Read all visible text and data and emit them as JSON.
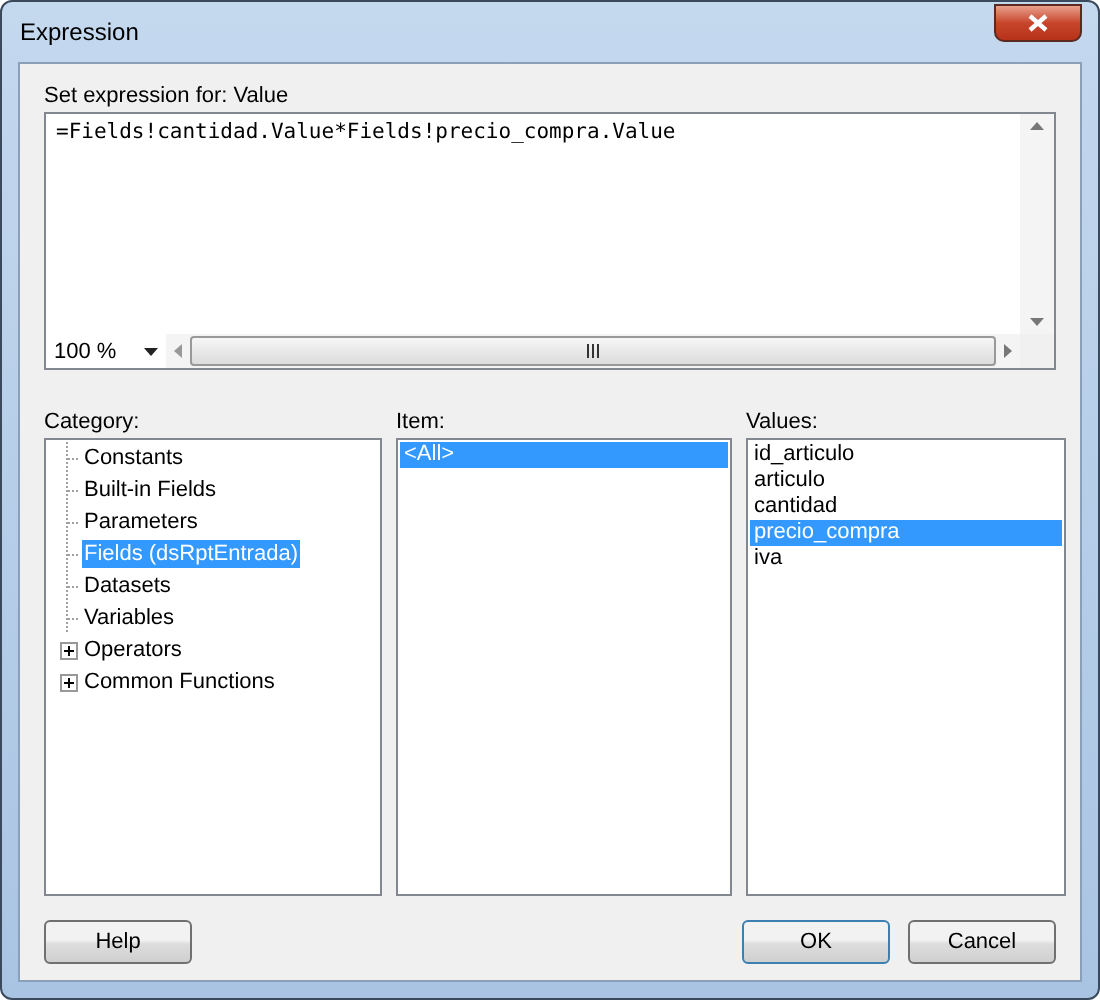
{
  "window": {
    "title": "Expression"
  },
  "expression": {
    "label": "Set expression for: Value",
    "value": "=Fields!cantidad.Value*Fields!precio_compra.Value",
    "zoom": "100 %"
  },
  "category": {
    "label": "Category:",
    "items": [
      {
        "label": "Constants",
        "selected": false,
        "expandable": false
      },
      {
        "label": "Built-in Fields",
        "selected": false,
        "expandable": false
      },
      {
        "label": "Parameters",
        "selected": false,
        "expandable": false
      },
      {
        "label": "Fields (dsRptEntrada)",
        "selected": true,
        "expandable": false
      },
      {
        "label": "Datasets",
        "selected": false,
        "expandable": false
      },
      {
        "label": "Variables",
        "selected": false,
        "expandable": false
      },
      {
        "label": "Operators",
        "selected": false,
        "expandable": true
      },
      {
        "label": "Common Functions",
        "selected": false,
        "expandable": true
      }
    ]
  },
  "item": {
    "label": "Item:",
    "items": [
      {
        "label": "<All>",
        "selected": true
      }
    ]
  },
  "values": {
    "label": "Values:",
    "items": [
      {
        "label": "id_articulo",
        "selected": false
      },
      {
        "label": "articulo",
        "selected": false
      },
      {
        "label": "cantidad",
        "selected": false
      },
      {
        "label": "precio_compra",
        "selected": true
      },
      {
        "label": "iva",
        "selected": false
      }
    ]
  },
  "buttons": {
    "help": "Help",
    "ok": "OK",
    "cancel": "Cancel"
  }
}
